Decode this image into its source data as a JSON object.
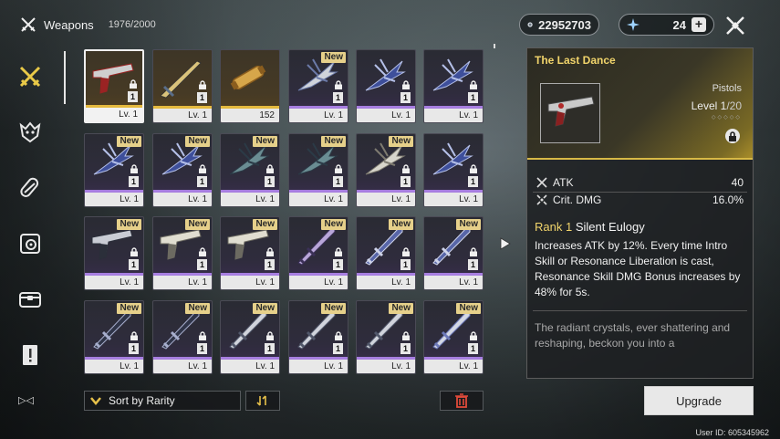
{
  "header": {
    "title": "Weapons",
    "count": "1976/2000"
  },
  "currencies": {
    "shell_credit": "22952703",
    "astrite": "24",
    "plus": "+"
  },
  "sidebar": {
    "items": [
      {
        "icon": "weapons-icon",
        "active": true
      },
      {
        "icon": "echo-icon",
        "active": false
      },
      {
        "icon": "supplies-icon",
        "active": false
      },
      {
        "icon": "resources-icon",
        "active": false
      },
      {
        "icon": "consumables-icon",
        "active": false
      },
      {
        "icon": "quest-item-icon",
        "active": false
      }
    ],
    "bottom_label": "▷◁"
  },
  "grid": {
    "cards": [
      {
        "name": "The Last Dance",
        "rank": "1",
        "level": "Lv. 1",
        "rarity": "gold",
        "selected": true,
        "new": false,
        "locked": true,
        "weapon": "pistol-red"
      },
      {
        "name": "Sword",
        "rank": "1",
        "level": "Lv. 1",
        "rarity": "gold",
        "selected": false,
        "new": false,
        "locked": true,
        "weapon": "sword-gold"
      },
      {
        "name": "Tuner",
        "rank": "",
        "level": "152",
        "rarity": "gold",
        "selected": false,
        "new": false,
        "locked": false,
        "weapon": "tube"
      },
      {
        "name": "Rectifier",
        "rank": "1",
        "level": "Lv. 1",
        "rarity": "purple",
        "selected": false,
        "new": true,
        "locked": true,
        "weapon": "rectifier-silver"
      },
      {
        "name": "Rectifier",
        "rank": "1",
        "level": "Lv. 1",
        "rarity": "purple",
        "selected": false,
        "new": false,
        "locked": true,
        "weapon": "rectifier-blue"
      },
      {
        "name": "Rectifier",
        "rank": "1",
        "level": "Lv. 1",
        "rarity": "purple",
        "selected": false,
        "new": false,
        "locked": true,
        "weapon": "rectifier-blue"
      },
      {
        "name": "Rectifier",
        "rank": "1",
        "level": "Lv. 1",
        "rarity": "purple",
        "selected": false,
        "new": true,
        "locked": true,
        "weapon": "rectifier-blue"
      },
      {
        "name": "Rectifier",
        "rank": "1",
        "level": "Lv. 1",
        "rarity": "purple",
        "selected": false,
        "new": true,
        "locked": true,
        "weapon": "rectifier-blue"
      },
      {
        "name": "Rectifier",
        "rank": "1",
        "level": "Lv. 1",
        "rarity": "purple",
        "selected": false,
        "new": true,
        "locked": true,
        "weapon": "rectifier-teal"
      },
      {
        "name": "Rectifier",
        "rank": "1",
        "level": "Lv. 1",
        "rarity": "purple",
        "selected": false,
        "new": true,
        "locked": true,
        "weapon": "rectifier-teal"
      },
      {
        "name": "Rectifier",
        "rank": "1",
        "level": "Lv. 1",
        "rarity": "purple",
        "selected": false,
        "new": true,
        "locked": true,
        "weapon": "rectifier-white"
      },
      {
        "name": "Rectifier",
        "rank": "1",
        "level": "Lv. 1",
        "rarity": "purple",
        "selected": false,
        "new": false,
        "locked": true,
        "weapon": "rectifier-blue"
      },
      {
        "name": "Pistols",
        "rank": "1",
        "level": "Lv. 1",
        "rarity": "purple",
        "selected": false,
        "new": true,
        "locked": true,
        "weapon": "pistol-silver"
      },
      {
        "name": "Pistols",
        "rank": "1",
        "level": "Lv. 1",
        "rarity": "purple",
        "selected": false,
        "new": true,
        "locked": true,
        "weapon": "pistol-white"
      },
      {
        "name": "Pistols",
        "rank": "1",
        "level": "Lv. 1",
        "rarity": "purple",
        "selected": false,
        "new": true,
        "locked": true,
        "weapon": "pistol-white"
      },
      {
        "name": "Sword",
        "rank": "1",
        "level": "Lv. 1",
        "rarity": "purple",
        "selected": false,
        "new": true,
        "locked": true,
        "weapon": "blade-purple"
      },
      {
        "name": "Sword",
        "rank": "1",
        "level": "Lv. 1",
        "rarity": "purple",
        "selected": false,
        "new": true,
        "locked": true,
        "weapon": "blade-blue"
      },
      {
        "name": "Sword",
        "rank": "1",
        "level": "Lv. 1",
        "rarity": "purple",
        "selected": false,
        "new": true,
        "locked": true,
        "weapon": "blade-blue"
      },
      {
        "name": "Sword",
        "rank": "1",
        "level": "Lv. 1",
        "rarity": "purple",
        "selected": false,
        "new": true,
        "locked": true,
        "weapon": "blade-dark"
      },
      {
        "name": "Sword",
        "rank": "1",
        "level": "Lv. 1",
        "rarity": "purple",
        "selected": false,
        "new": true,
        "locked": true,
        "weapon": "blade-dark"
      },
      {
        "name": "Sword",
        "rank": "1",
        "level": "Lv. 1",
        "rarity": "purple",
        "selected": false,
        "new": true,
        "locked": true,
        "weapon": "blade-silver"
      },
      {
        "name": "Sword",
        "rank": "1",
        "level": "Lv. 1",
        "rarity": "purple",
        "selected": false,
        "new": true,
        "locked": true,
        "weapon": "blade-silver"
      },
      {
        "name": "Sword",
        "rank": "1",
        "level": "Lv. 1",
        "rarity": "purple",
        "selected": false,
        "new": true,
        "locked": true,
        "weapon": "blade-silver"
      },
      {
        "name": "Sword",
        "rank": "1",
        "level": "Lv. 1",
        "rarity": "purple",
        "selected": false,
        "new": true,
        "locked": true,
        "weapon": "blade-ornate"
      }
    ],
    "new_label": "New"
  },
  "toolbar": {
    "sort_label": "Sort by Rarity"
  },
  "detail": {
    "title": "The Last Dance",
    "type": "Pistols",
    "level_label": "Level",
    "level_value": "1",
    "level_max": "/20",
    "dots": "◇◇◇◇◇",
    "stats": [
      {
        "icon": "atk-icon",
        "label": "ATK",
        "value": "40"
      },
      {
        "icon": "crit-dmg-icon",
        "label": "Crit. DMG",
        "value": "16.0%"
      }
    ],
    "passive_rank": "Rank 1",
    "passive_name": "Silent Eulogy",
    "passive_desc": "Increases ATK by 12%. Every time Intro Skill or Resonance Liberation is cast, Resonance Skill DMG Bonus increases by 48% for 5s.",
    "lore": "The radiant crystals, ever shattering and reshaping, beckon you into a"
  },
  "upgrade_label": "Upgrade",
  "user_id": "User ID: 605345962",
  "colors": {
    "gold": "#e5b93e",
    "purple": "#a77ee0",
    "title_gold": "#f1d46b",
    "new_badge": "#e6d08a"
  }
}
